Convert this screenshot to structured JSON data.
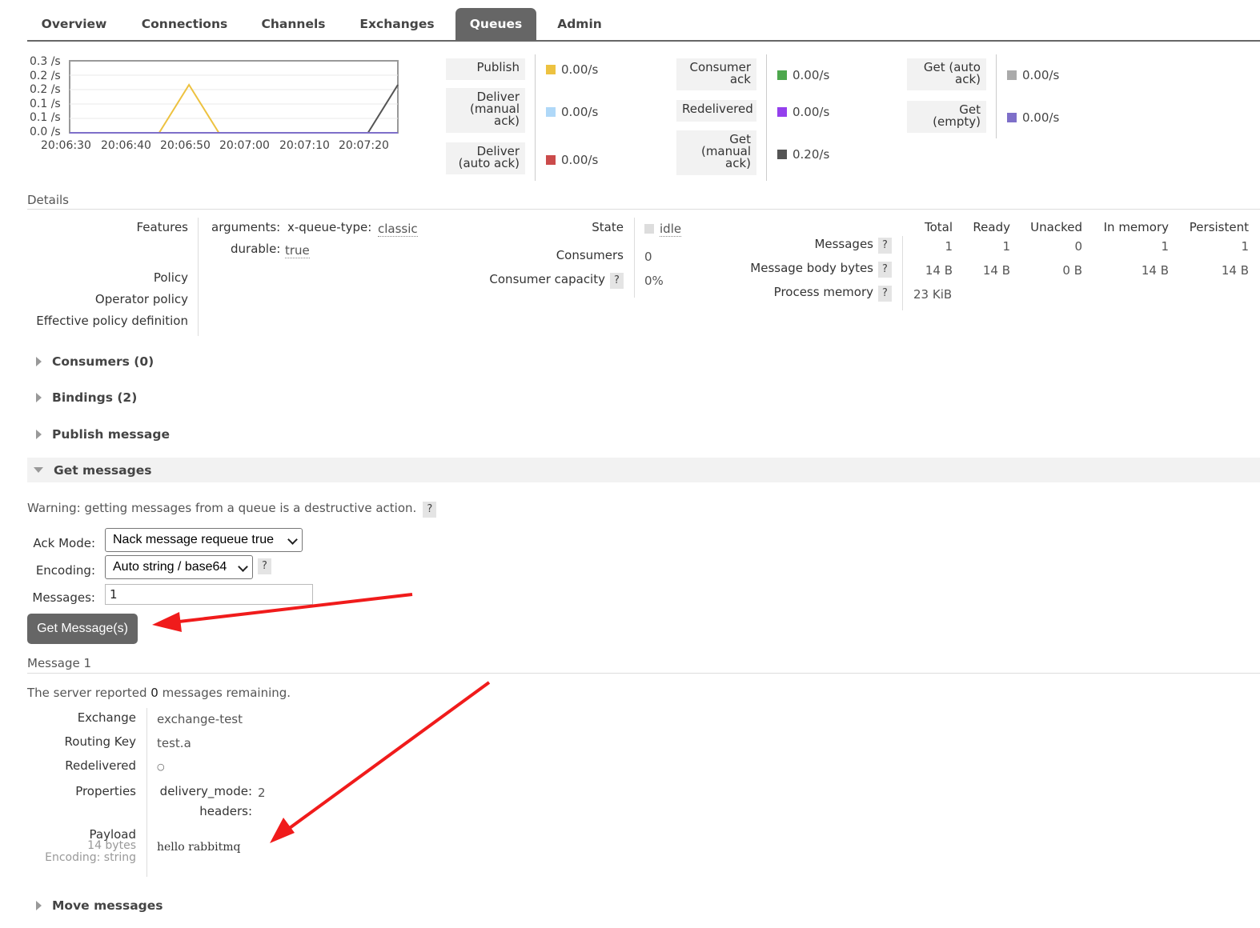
{
  "tabs": [
    "Overview",
    "Connections",
    "Channels",
    "Exchanges",
    "Queues",
    "Admin"
  ],
  "active_tab": "Queues",
  "chart": {
    "y_ticks": [
      "0.3 /s",
      "0.2 /s",
      "0.2 /s",
      "0.1 /s",
      "0.1 /s",
      "0.0 /s"
    ],
    "x_ticks": [
      "20:06:30",
      "20:06:40",
      "20:06:50",
      "20:07:00",
      "20:07:10",
      "20:07:20"
    ]
  },
  "chart_data": {
    "type": "line",
    "x": [
      "20:06:30",
      "20:06:35",
      "20:06:40",
      "20:06:45",
      "20:06:50",
      "20:06:55",
      "20:07:00",
      "20:07:05",
      "20:07:10",
      "20:07:15",
      "20:07:20",
      "20:07:25"
    ],
    "series": [
      {
        "color": "#edc240",
        "values": [
          0,
          0,
          0,
          0,
          0.2,
          0,
          0,
          0,
          0,
          0,
          0,
          0
        ]
      },
      {
        "color": "#545454",
        "values": [
          0,
          0,
          0,
          0,
          0,
          0,
          0,
          0,
          0,
          0,
          0,
          0.2
        ]
      },
      {
        "color": "#7e6fc9",
        "values": [
          0,
          0,
          0,
          0,
          0,
          0,
          0,
          0,
          0,
          0,
          0,
          0
        ]
      }
    ],
    "ylim": [
      0,
      0.3
    ],
    "y_tick_labels": [
      "0.3 /s",
      "0.2 /s",
      "0.2 /s",
      "0.1 /s",
      "0.1 /s",
      "0.0 /s"
    ],
    "x_tick_labels": [
      "20:06:30",
      "20:06:40",
      "20:06:50",
      "20:07:00",
      "20:07:10",
      "20:07:20"
    ],
    "grid": true
  },
  "rates": {
    "col1": [
      {
        "label": "Publish",
        "value": "0.00/s",
        "color": "#edc240"
      },
      {
        "label": "Deliver (manual ack)",
        "value": "0.00/s",
        "color": "#afd8f8"
      },
      {
        "label": "Deliver (auto ack)",
        "value": "0.00/s",
        "color": "#cb4b4b"
      }
    ],
    "col2": [
      {
        "label": "Consumer ack",
        "value": "0.00/s",
        "color": "#4da74d"
      },
      {
        "label": "Redelivered",
        "value": "0.00/s",
        "color": "#9440ed"
      },
      {
        "label": "Get (manual ack)",
        "value": "0.20/s",
        "color": "#545454"
      }
    ],
    "col3": [
      {
        "label": "Get (auto ack)",
        "value": "0.00/s",
        "color": "#aaaaaa"
      },
      {
        "label": "Get (empty)",
        "value": "0.00/s",
        "color": "#7e6fc9"
      }
    ]
  },
  "details": {
    "title": "Details",
    "features_label": "Features",
    "arguments_key": "arguments:",
    "queue_type_key": "x-queue-type:",
    "queue_type_val": "classic",
    "durable_key": "durable:",
    "durable_val": "true",
    "policy_label": "Policy",
    "operator_policy_label": "Operator policy",
    "effective_policy_label": "Effective policy definition",
    "state_label": "State",
    "state_val": "idle",
    "consumers_label": "Consumers",
    "consumers_val": "0",
    "consumer_capacity_label": "Consumer capacity",
    "consumer_capacity_val": "0%",
    "help": "?",
    "msg_headers": [
      "Total",
      "Ready",
      "Unacked",
      "In memory",
      "Persistent"
    ],
    "messages_label": "Messages",
    "messages_vals": [
      "1",
      "1",
      "0",
      "1",
      "1"
    ],
    "body_bytes_label": "Message body bytes",
    "body_bytes_vals": [
      "14 B",
      "14 B",
      "0 B",
      "14 B",
      "14 B"
    ],
    "process_memory_label": "Process memory",
    "process_memory_val": "23 KiB"
  },
  "sections": {
    "consumers": "Consumers (0)",
    "bindings": "Bindings (2)",
    "publish": "Publish message",
    "get": "Get messages",
    "move": "Move messages"
  },
  "get": {
    "warning": "Warning: getting messages from a queue is a destructive action.",
    "ack_mode_label": "Ack Mode:",
    "ack_mode_value": "Nack message requeue true",
    "encoding_label": "Encoding:",
    "encoding_value": "Auto string / base64",
    "messages_label": "Messages:",
    "messages_value": "1",
    "button": "Get Message(s)"
  },
  "message": {
    "title": "Message 1",
    "remaining_prefix": "The server reported ",
    "remaining_count": "0",
    "remaining_suffix": " messages remaining.",
    "exchange_label": "Exchange",
    "exchange_val": "exchange-test",
    "routing_key_label": "Routing Key",
    "routing_key_val": "test.a",
    "redelivered_label": "Redelivered",
    "redelivered_val": "○",
    "properties_label": "Properties",
    "delivery_mode_key": "delivery_mode:",
    "delivery_mode_val": "2",
    "headers_key": "headers:",
    "payload_label": "Payload",
    "payload_size": "14 bytes",
    "payload_encoding": "Encoding: string",
    "payload_val": "hello rabbitmq"
  }
}
